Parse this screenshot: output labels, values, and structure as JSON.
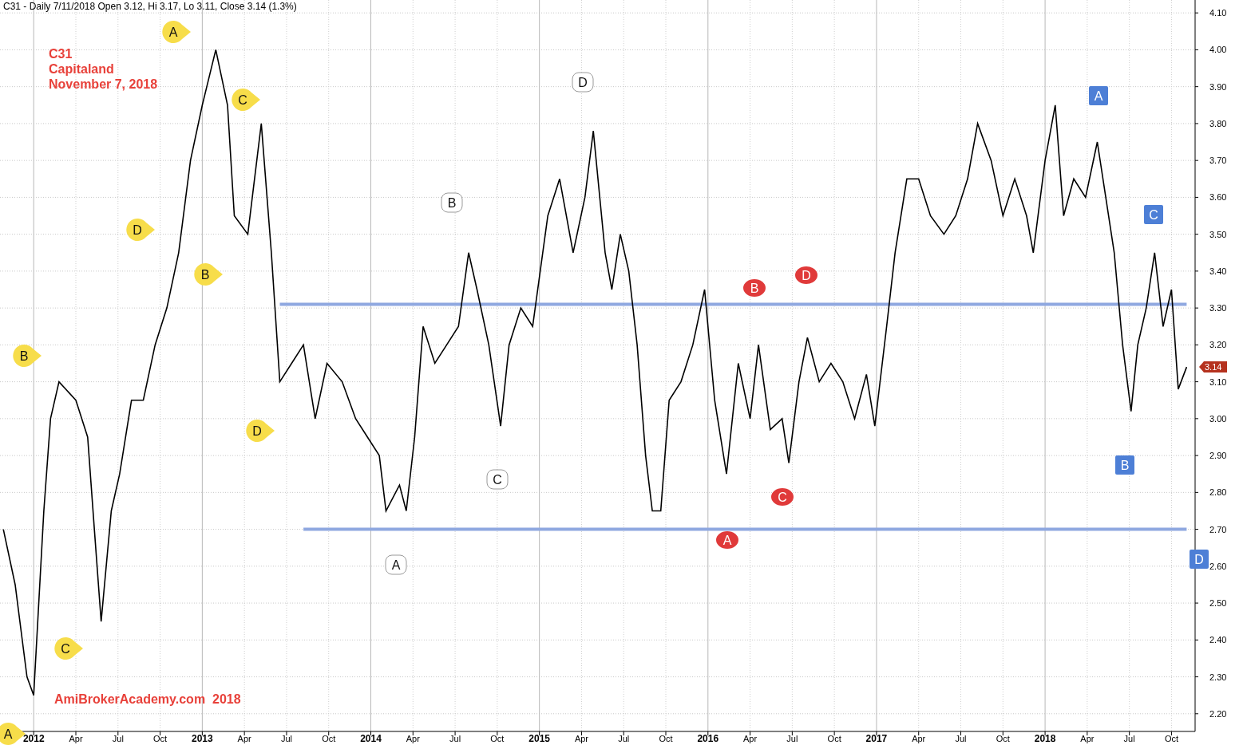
{
  "chart": {
    "chart_data": {
      "type": "line",
      "title": "C31 - Daily 7/11/2018 Open 3.12, Hi 3.17, Lo 3.11, Close 3.14 (1.3%)",
      "x": [
        2011.82,
        2011.89,
        2011.96,
        2012.0,
        2012.06,
        2012.1,
        2012.15,
        2012.25,
        2012.32,
        2012.36,
        2012.4,
        2012.46,
        2012.51,
        2012.58,
        2012.65,
        2012.72,
        2012.79,
        2012.86,
        2012.93,
        2013.0,
        2013.08,
        2013.15,
        2013.19,
        2013.27,
        2013.35,
        2013.41,
        2013.46,
        2013.53,
        2013.6,
        2013.67,
        2013.74,
        2013.83,
        2013.91,
        2013.98,
        2014.05,
        2014.09,
        2014.17,
        2014.21,
        2014.26,
        2014.31,
        2014.38,
        2014.45,
        2014.52,
        2014.58,
        2014.63,
        2014.7,
        2014.77,
        2014.82,
        2014.89,
        2014.96,
        2015.05,
        2015.12,
        2015.2,
        2015.27,
        2015.32,
        2015.39,
        2015.43,
        2015.48,
        2015.53,
        2015.58,
        2015.63,
        2015.67,
        2015.72,
        2015.77,
        2015.84,
        2015.91,
        2015.98,
        2016.04,
        2016.11,
        2016.18,
        2016.25,
        2016.3,
        2016.37,
        2016.44,
        2016.48,
        2016.54,
        2016.59,
        2016.66,
        2016.73,
        2016.8,
        2016.87,
        2016.94,
        2016.99,
        2017.06,
        2017.11,
        2017.18,
        2017.25,
        2017.32,
        2017.4,
        2017.47,
        2017.54,
        2017.6,
        2017.68,
        2017.75,
        2017.82,
        2017.89,
        2017.93,
        2018.0,
        2018.06,
        2018.11,
        2018.17,
        2018.24,
        2018.31,
        2018.36,
        2018.41,
        2018.46,
        2018.51,
        2018.55,
        2018.6,
        2018.65,
        2018.7,
        2018.75,
        2018.79,
        2018.84
      ],
      "series": [
        {
          "color": "#000000",
          "values": [
            2.7,
            2.55,
            2.3,
            2.25,
            2.75,
            3.0,
            3.1,
            3.05,
            2.95,
            2.7,
            2.45,
            2.75,
            2.85,
            3.05,
            3.05,
            3.2,
            3.3,
            3.45,
            3.7,
            3.85,
            4.0,
            3.85,
            3.55,
            3.5,
            3.8,
            3.45,
            3.1,
            3.15,
            3.2,
            3.0,
            3.15,
            3.1,
            3.0,
            2.95,
            2.9,
            2.75,
            2.82,
            2.75,
            2.95,
            3.25,
            3.15,
            3.2,
            3.25,
            3.45,
            3.35,
            3.2,
            2.98,
            3.2,
            3.3,
            3.25,
            3.55,
            3.65,
            3.45,
            3.6,
            3.78,
            3.45,
            3.35,
            3.5,
            3.4,
            3.2,
            2.9,
            2.75,
            2.75,
            3.05,
            3.1,
            3.2,
            3.35,
            3.05,
            2.85,
            3.15,
            3.0,
            3.2,
            2.97,
            3.0,
            2.88,
            3.1,
            3.22,
            3.1,
            3.15,
            3.1,
            3.0,
            3.12,
            2.98,
            3.25,
            3.45,
            3.65,
            3.65,
            3.55,
            3.5,
            3.55,
            3.65,
            3.8,
            3.7,
            3.55,
            3.65,
            3.55,
            3.45,
            3.7,
            3.85,
            3.55,
            3.65,
            3.6,
            3.75,
            3.6,
            3.45,
            3.2,
            3.02,
            3.2,
            3.3,
            3.45,
            3.25,
            3.35,
            3.08,
            3.14
          ]
        },
        {
          "color": "#8fa8e0",
          "values": [
            null,
            null,
            null,
            null,
            null,
            null,
            null,
            null,
            null,
            null,
            null,
            null,
            null,
            null,
            null,
            null,
            null,
            null,
            null,
            null,
            null,
            null,
            null,
            null,
            null,
            null,
            3.31,
            3.31,
            3.31,
            3.31,
            3.31,
            3.31,
            3.31,
            3.31,
            3.31,
            3.31,
            3.31,
            3.31,
            3.31,
            3.31,
            3.31,
            3.31,
            3.31,
            3.31,
            3.31,
            3.31,
            3.31,
            3.31,
            3.31,
            3.31,
            3.31,
            3.31,
            3.31,
            3.31,
            3.31,
            3.31,
            3.31,
            3.31,
            3.31,
            3.31,
            3.31,
            3.31,
            3.31,
            3.31,
            3.31,
            3.31,
            3.31,
            3.31,
            3.31,
            3.31,
            3.31,
            3.31,
            3.31,
            3.31,
            3.31,
            3.31,
            3.31,
            3.31,
            3.31,
            3.31,
            3.31,
            3.31,
            3.31,
            3.31,
            3.31,
            3.31,
            3.31,
            3.31,
            3.31,
            3.31,
            3.31,
            3.31,
            3.31,
            3.31,
            3.31,
            3.31,
            3.31,
            3.31,
            3.31,
            3.31,
            3.31,
            3.31,
            3.31,
            3.31,
            3.31,
            3.31,
            3.31,
            3.31,
            3.31,
            3.31,
            3.31,
            3.31,
            3.31,
            3.31
          ]
        },
        {
          "color": "#8fa8e0",
          "values": [
            null,
            null,
            null,
            null,
            null,
            null,
            null,
            null,
            null,
            null,
            null,
            null,
            null,
            null,
            null,
            null,
            null,
            null,
            null,
            null,
            null,
            null,
            null,
            null,
            null,
            null,
            null,
            null,
            2.7,
            2.7,
            2.7,
            2.7,
            2.7,
            2.7,
            2.7,
            2.7,
            2.7,
            2.7,
            2.7,
            2.7,
            2.7,
            2.7,
            2.7,
            2.7,
            2.7,
            2.7,
            2.7,
            2.7,
            2.7,
            2.7,
            2.7,
            2.7,
            2.7,
            2.7,
            2.7,
            2.7,
            2.7,
            2.7,
            2.7,
            2.7,
            2.7,
            2.7,
            2.7,
            2.7,
            2.7,
            2.7,
            2.7,
            2.7,
            2.7,
            2.7,
            2.7,
            2.7,
            2.7,
            2.7,
            2.7,
            2.7,
            2.7,
            2.7,
            2.7,
            2.7,
            2.7,
            2.7,
            2.7,
            2.7,
            2.7,
            2.7,
            2.7,
            2.7,
            2.7,
            2.7,
            2.7,
            2.7,
            2.7,
            2.7,
            2.7,
            2.7,
            2.7,
            2.7,
            2.7,
            2.7,
            2.7,
            2.7,
            2.7,
            2.7,
            2.7,
            2.7,
            2.7,
            2.7,
            2.7,
            2.7,
            2.7,
            2.7,
            2.7,
            2.7
          ]
        }
      ],
      "xlim": [
        2011.8,
        2018.89
      ],
      "ylim": [
        2.152,
        4.135
      ],
      "grid": true,
      "xticks": [
        {
          "value": 2012,
          "label": "2012"
        },
        {
          "value": 2012.25,
          "label": "Apr"
        },
        {
          "value": 2012.5,
          "label": "Jul"
        },
        {
          "value": 2012.75,
          "label": "Oct"
        },
        {
          "value": 2013,
          "label": "2013"
        },
        {
          "value": 2013.25,
          "label": "Apr"
        },
        {
          "value": 2013.5,
          "label": "Jul"
        },
        {
          "value": 2013.75,
          "label": "Oct"
        },
        {
          "value": 2014,
          "label": "2014"
        },
        {
          "value": 2014.25,
          "label": "Apr"
        },
        {
          "value": 2014.5,
          "label": "Jul"
        },
        {
          "value": 2014.75,
          "label": "Oct"
        },
        {
          "value": 2015,
          "label": "2015"
        },
        {
          "value": 2015.25,
          "label": "Apr"
        },
        {
          "value": 2015.5,
          "label": "Jul"
        },
        {
          "value": 2015.75,
          "label": "Oct"
        },
        {
          "value": 2016,
          "label": "2016"
        },
        {
          "value": 2016.25,
          "label": "Apr"
        },
        {
          "value": 2016.5,
          "label": "Jul"
        },
        {
          "value": 2016.75,
          "label": "Oct"
        },
        {
          "value": 2017,
          "label": "2017"
        },
        {
          "value": 2017.25,
          "label": "Apr"
        },
        {
          "value": 2017.5,
          "label": "Jul"
        },
        {
          "value": 2017.75,
          "label": "Oct"
        },
        {
          "value": 2018,
          "label": "2018"
        },
        {
          "value": 2018.25,
          "label": "Apr"
        },
        {
          "value": 2018.5,
          "label": "Jul"
        },
        {
          "value": 2018.75,
          "label": "Oct"
        }
      ],
      "yticks": [
        {
          "value": 2.2,
          "label": "2.20"
        },
        {
          "value": 2.3,
          "label": "2.30"
        },
        {
          "value": 2.4,
          "label": "2.40"
        },
        {
          "value": 2.5,
          "label": "2.50"
        },
        {
          "value": 2.6,
          "label": "2.60"
        },
        {
          "value": 2.7,
          "label": "2.70"
        },
        {
          "value": 2.8,
          "label": "2.80"
        },
        {
          "value": 2.9,
          "label": "2.90"
        },
        {
          "value": 3.0,
          "label": "3.00"
        },
        {
          "value": 3.1,
          "label": "3.10"
        },
        {
          "value": 3.2,
          "label": "3.20"
        },
        {
          "value": 3.3,
          "label": "3.30"
        },
        {
          "value": 3.4,
          "label": "3.40"
        },
        {
          "value": 3.5,
          "label": "3.50"
        },
        {
          "value": 3.6,
          "label": "3.60"
        },
        {
          "value": 3.7,
          "label": "3.70"
        },
        {
          "value": 3.8,
          "label": "3.80"
        },
        {
          "value": 3.9,
          "label": "3.90"
        },
        {
          "value": 4.0,
          "label": "4.00"
        },
        {
          "value": 4.1,
          "label": "4.10"
        }
      ]
    },
    "markers": [
      {
        "kind": "pin",
        "color": "#f7dd4a",
        "text": "A"
      },
      {
        "kind": "pin",
        "color": "#f7dd4a",
        "text": "A"
      },
      {
        "kind": "pin",
        "color": "#f7dd4a",
        "text": "C"
      },
      {
        "kind": "pin",
        "color": "#f7dd4a",
        "text": "D"
      },
      {
        "kind": "pin",
        "color": "#f7dd4a",
        "text": "B"
      },
      {
        "kind": "pin",
        "color": "#f7dd4a",
        "text": "B"
      },
      {
        "kind": "pin",
        "color": "#f7dd4a",
        "text": "D"
      },
      {
        "kind": "pin",
        "color": "#f7dd4a",
        "text": "C"
      },
      {
        "kind": "tag",
        "color": "#ffffff",
        "text": "D"
      },
      {
        "kind": "tag",
        "color": "#ffffff",
        "text": "B"
      },
      {
        "kind": "tag",
        "color": "#ffffff",
        "text": "C"
      },
      {
        "kind": "tag",
        "color": "#ffffff",
        "text": "A"
      },
      {
        "kind": "dot",
        "color": "#e03a3a",
        "text": "B"
      },
      {
        "kind": "dot",
        "color": "#e03a3a",
        "text": "D"
      },
      {
        "kind": "dot",
        "color": "#e03a3a",
        "text": "C"
      },
      {
        "kind": "dot",
        "color": "#e03a3a",
        "text": "A"
      },
      {
        "kind": "square",
        "color": "#4d7fd6",
        "text": "A"
      },
      {
        "kind": "square",
        "color": "#4d7fd6",
        "text": "C"
      },
      {
        "kind": "square",
        "color": "#4d7fd6",
        "text": "B"
      },
      {
        "kind": "square",
        "color": "#4d7fd6",
        "text": "D"
      }
    ],
    "note_lines": [
      "C31",
      "Capitaland",
      "November 7, 2018"
    ],
    "footer_note": "AmiBrokerAcademy.com  2018",
    "last_price": "3.14"
  }
}
